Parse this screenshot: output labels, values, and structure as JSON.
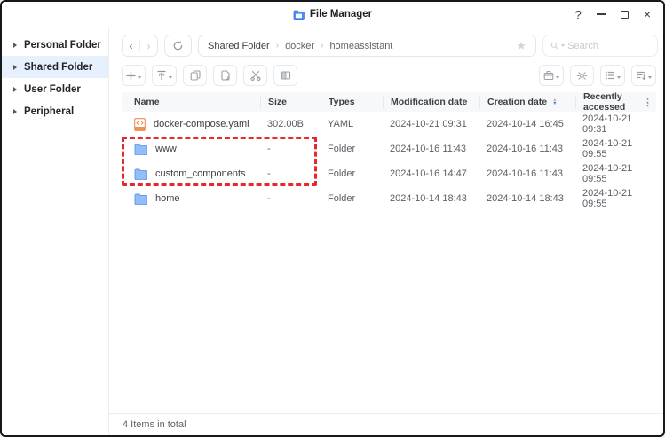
{
  "window": {
    "title": "File Manager",
    "controls": {
      "help": "?",
      "close": "×"
    }
  },
  "sidebar": {
    "items": [
      {
        "label": "Personal Folder",
        "selected": false
      },
      {
        "label": "Shared Folder",
        "selected": true
      },
      {
        "label": "User Folder",
        "selected": false
      },
      {
        "label": "Peripheral",
        "selected": false
      }
    ]
  },
  "nav": {
    "breadcrumb": {
      "0": "Shared Folder",
      "1": "docker",
      "2": "homeassistant"
    },
    "search": {
      "placeholder": "Search"
    }
  },
  "toolbar": {
    "left": [
      "add",
      "upload",
      "copy",
      "paste",
      "cut",
      "rename"
    ],
    "right": [
      "tools",
      "settings",
      "view-mode",
      "sort"
    ]
  },
  "icons": {
    "back": "‹",
    "forward": "›",
    "breadcrumb_separator": "›",
    "star": "★",
    "plus": "+",
    "more_vertical": "⋮",
    "sort_asc": "▲",
    "sort_desc": "▼"
  },
  "table": {
    "columns": {
      "name": "Name",
      "size": "Size",
      "types": "Types",
      "modification": "Modification date",
      "creation": "Creation date",
      "accessed": "Recently accessed"
    },
    "sorted_by": "Creation date",
    "rows": [
      {
        "icon": "yaml-file-icon",
        "name": "docker-compose.yaml",
        "size": "302.00B",
        "type": "YAML",
        "modified": "2024-10-21 09:31",
        "created": "2024-10-14 16:45",
        "accessed": "2024-10-21 09:31"
      },
      {
        "icon": "folder-icon",
        "name": "www",
        "size": "-",
        "type": "Folder",
        "modified": "2024-10-16 11:43",
        "created": "2024-10-16 11:43",
        "accessed": "2024-10-21 09:55"
      },
      {
        "icon": "folder-icon",
        "name": "custom_components",
        "size": "-",
        "type": "Folder",
        "modified": "2024-10-16 14:47",
        "created": "2024-10-16 11:43",
        "accessed": "2024-10-21 09:55"
      },
      {
        "icon": "folder-icon",
        "name": "home",
        "size": "-",
        "type": "Folder",
        "modified": "2024-10-14 18:43",
        "created": "2024-10-14 18:43",
        "accessed": "2024-10-21 09:55"
      }
    ]
  },
  "annotation": {
    "type": "red-dashed-box",
    "color": "#e8272c",
    "highlighted_rows": [
      "www",
      "custom_components"
    ]
  },
  "footer": {
    "status": "4 Items in total"
  }
}
